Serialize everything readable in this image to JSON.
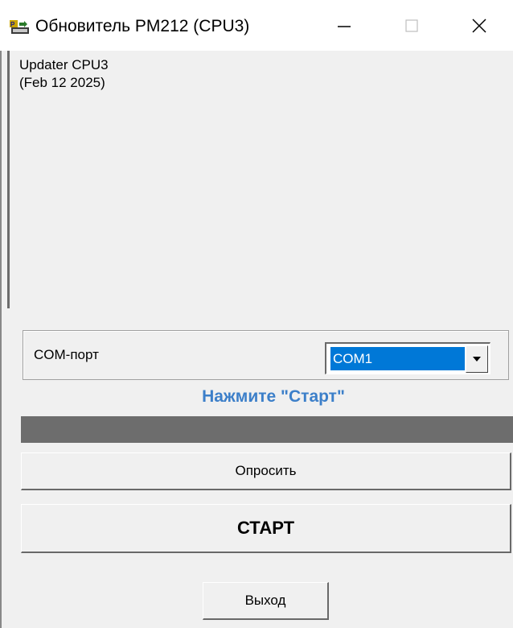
{
  "window": {
    "title": "Обновитель PM212 (CPU3)",
    "controls": [
      "minimize",
      "maximize",
      "close"
    ]
  },
  "log": {
    "lines": [
      "Updater CPU3",
      "(Feb 12 2025)"
    ]
  },
  "com_port": {
    "label": "COM-порт",
    "selected": "COM1"
  },
  "status": {
    "text": "Нажмите \"Старт\"",
    "color": "#3c7fc9"
  },
  "progress": {
    "fraction": 0
  },
  "buttons": {
    "poll": "Опросить",
    "start": "СТАРТ",
    "exit": "Выход"
  },
  "colors": {
    "selection": "#0078d7",
    "progress_bg": "#6d6d6d"
  }
}
